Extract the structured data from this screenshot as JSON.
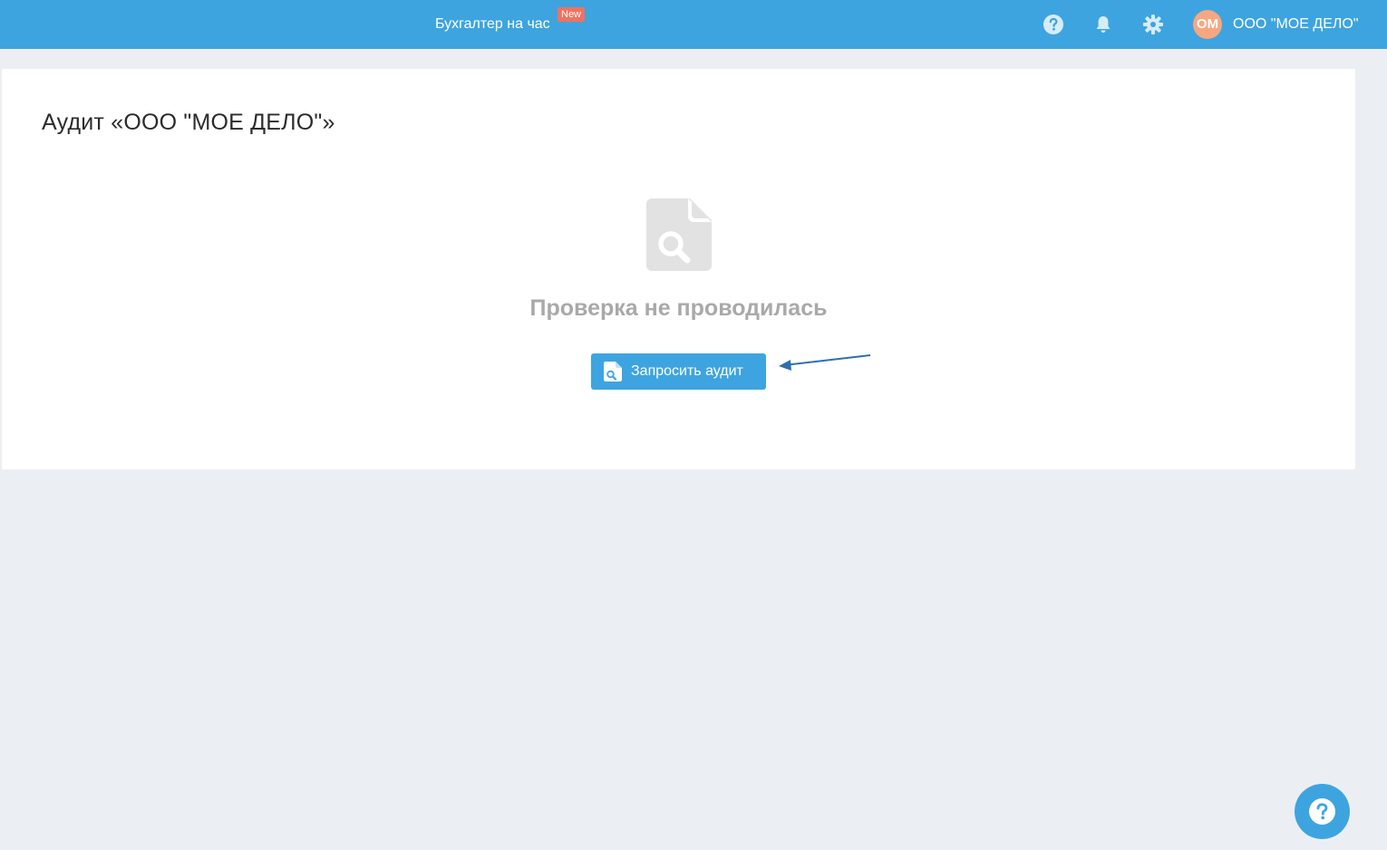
{
  "header": {
    "accountant_link": "Бухгалтер на час",
    "new_badge": "New",
    "help_icon": "question-circle-icon",
    "notifications_icon": "bell-icon",
    "settings_icon": "gear-icon",
    "avatar_initials": "ОМ",
    "org_name": "ООО \"МОЕ ДЕЛО\""
  },
  "main": {
    "title": "Аудит «ООО \"МОЕ ДЕЛО\"»",
    "empty_state_icon": "document-search-icon",
    "empty_state_text": "Проверка не проводилась",
    "request_button_icon": "document-search-icon",
    "request_button_label": "Запросить аудит"
  },
  "help_fab": {
    "icon": "question-circle-icon"
  },
  "colors": {
    "brand_blue": "#3ea4df",
    "badge_red": "#f07261",
    "avatar_orange": "#f6a77f",
    "page_background": "#ebeff3",
    "muted_text": "#a9a9a9",
    "annotation_arrow": "#2f6faf"
  }
}
